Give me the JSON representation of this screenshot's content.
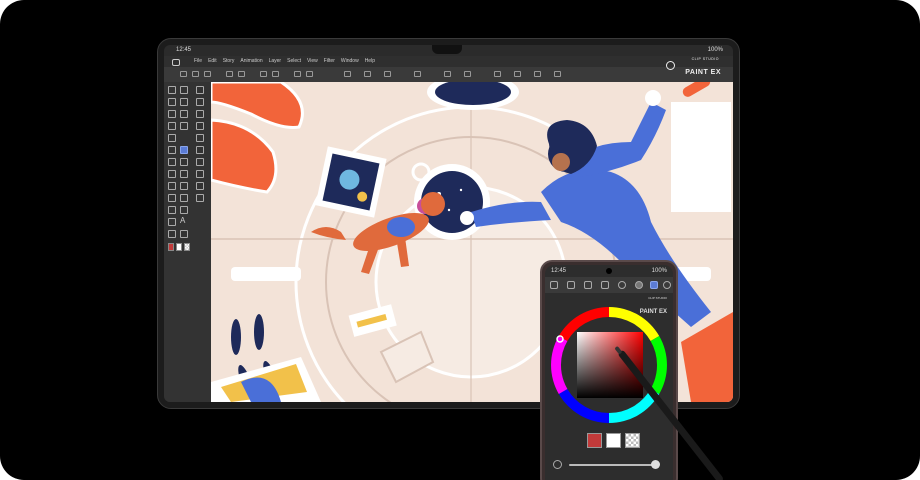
{
  "tablet": {
    "status_time": "12:45",
    "status_battery": "100%",
    "menu": [
      "File",
      "Edit",
      "Story",
      "Animation",
      "Layer",
      "Select",
      "View",
      "Filter",
      "Window",
      "Help"
    ],
    "logo_small": "CLIP STUDIO",
    "logo_big": "PAINT EX"
  },
  "phone": {
    "status_time": "12:45",
    "status_battery": "100%",
    "logo_small": "CLIP STUDIO",
    "logo_big": "PAINT EX"
  },
  "colors": {
    "main": "#c23a3a",
    "sub": "#ffffff",
    "transparent": "checker",
    "accent_orange": "#f2643a",
    "accent_blue": "#4a6fd8",
    "navy": "#1e2a5a",
    "background_beige": "#f3e3d8"
  },
  "icons": [
    "pen-icon",
    "hand-icon",
    "zoom-icon",
    "move-icon",
    "select-icon",
    "eyedropper-icon",
    "brush-icon",
    "eraser-icon",
    "fill-icon",
    "text-icon",
    "color-wheel-icon"
  ]
}
